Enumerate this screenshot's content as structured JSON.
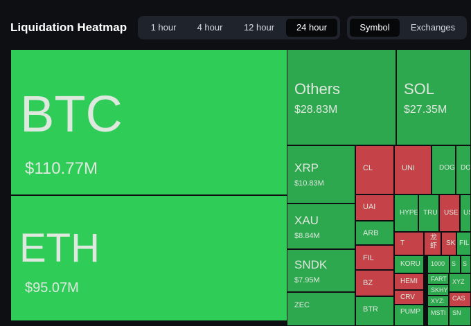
{
  "header": {
    "title": "Liquidation Heatmap",
    "time_options": [
      "1 hour",
      "4 hour",
      "12 hour",
      "24 hour"
    ],
    "time_selected": "24 hour",
    "view_options": [
      "Symbol",
      "Exchanges"
    ],
    "view_selected": "Symbol"
  },
  "colors": {
    "background": "#0d0f13",
    "long_liquidations_green": "#2fcc58",
    "mid_green": "#2ea84f",
    "short_liquidations_red": "#c44248"
  },
  "tiles": [
    {
      "symbol": "BTC",
      "value": "$110.77M"
    },
    {
      "symbol": "ETH",
      "value": "$95.07M"
    },
    {
      "symbol": "Others",
      "value": "$28.83M"
    },
    {
      "symbol": "SOL",
      "value": "$27.35M"
    },
    {
      "symbol": "XRP",
      "value": "$10.83M"
    },
    {
      "symbol": "XAU",
      "value": "$8.84M"
    },
    {
      "symbol": "SNDK",
      "value": "$7.95M"
    },
    {
      "symbol": "ZEC"
    },
    {
      "symbol": "CL"
    },
    {
      "symbol": "UNI"
    },
    {
      "symbol": "DOGE"
    },
    {
      "symbol": "UAI"
    },
    {
      "symbol": "HYPE"
    },
    {
      "symbol": "TRU"
    },
    {
      "symbol": "USE"
    },
    {
      "symbol": "ARB"
    },
    {
      "symbol": "T"
    },
    {
      "symbol": "龙虾"
    },
    {
      "symbol": "SK"
    },
    {
      "symbol": "FIL"
    },
    {
      "symbol": "KORU"
    },
    {
      "symbol": "1000"
    },
    {
      "symbol": "BZ"
    },
    {
      "symbol": "HEMI"
    },
    {
      "symbol": "FART"
    },
    {
      "symbol": "SKHY"
    },
    {
      "symbol": "CRV"
    },
    {
      "symbol": "XYZ:"
    },
    {
      "symbol": "BTR"
    },
    {
      "symbol": "PUMP"
    },
    {
      "symbol": "MSTI"
    },
    {
      "symbol": "XYZ"
    },
    {
      "symbol": "CAS"
    },
    {
      "symbol": "SN"
    },
    {
      "symbol": "S"
    },
    {
      "symbol": "SI"
    }
  ]
}
